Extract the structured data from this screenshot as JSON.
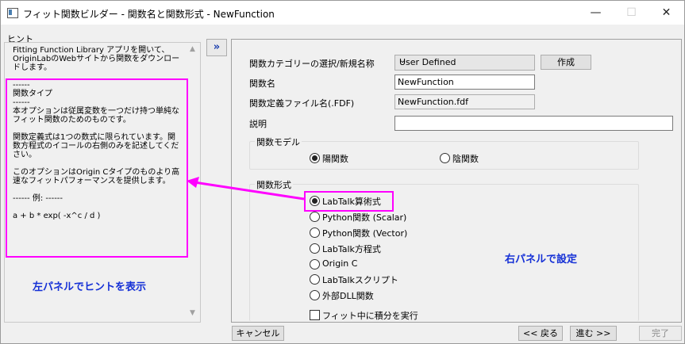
{
  "window": {
    "title": "フィット関数ビルダー - 関数名と関数形式 - NewFunction",
    "minimize": "—",
    "maximize": "☐",
    "close": "✕"
  },
  "left": {
    "hint_label": "ヒント",
    "hint_text": "Fitting Function Library アプリを開いて、OriginLabのWebサイトから関数をダウンロードします。\n\n------\n関数タイプ\n------\n本オプションは従属変数を一つだけ持つ単純なフィット関数のためのものです。\n\n関数定義式は1つの数式に限られています。関数方程式のイコールの右側のみを記述してください。\n\nこのオプションはOrigin Cタイプのものより高速なフィットパフォーマンスを提供します。\n\n------ 例: ------\n\na + b * exp( -x^c / d )",
    "note": "左パネルでヒントを表示"
  },
  "toggle_button": "»",
  "right": {
    "category_label": "関数カテゴリーの選択/新規名称",
    "category_value": "User Defined",
    "create_button": "作成",
    "name_label": "関数名",
    "name_value": "NewFunction",
    "file_label": "関数定義ファイル名(.FDF)",
    "file_value": "NewFunction.fdf",
    "desc_label": "説明",
    "desc_value": "",
    "model_group": "関数モデル",
    "model_options": [
      "陽関数",
      "陰関数"
    ],
    "form_group": "関数形式",
    "form_options": [
      "LabTalk算術式",
      "Python関数 (Scalar)",
      "Python関数 (Vector)",
      "LabTalk方程式",
      "Origin C",
      "LabTalkスクリプト",
      "外部DLL関数"
    ],
    "integrate_label": "フィット中に積分を実行",
    "note": "右パネルで設定"
  },
  "footer": {
    "cancel": "キャンセル",
    "back": "<< 戻る",
    "next": "進む >>",
    "finish": "完了"
  },
  "colors": {
    "highlight": "#ff00ff",
    "note": "#1530d6"
  }
}
